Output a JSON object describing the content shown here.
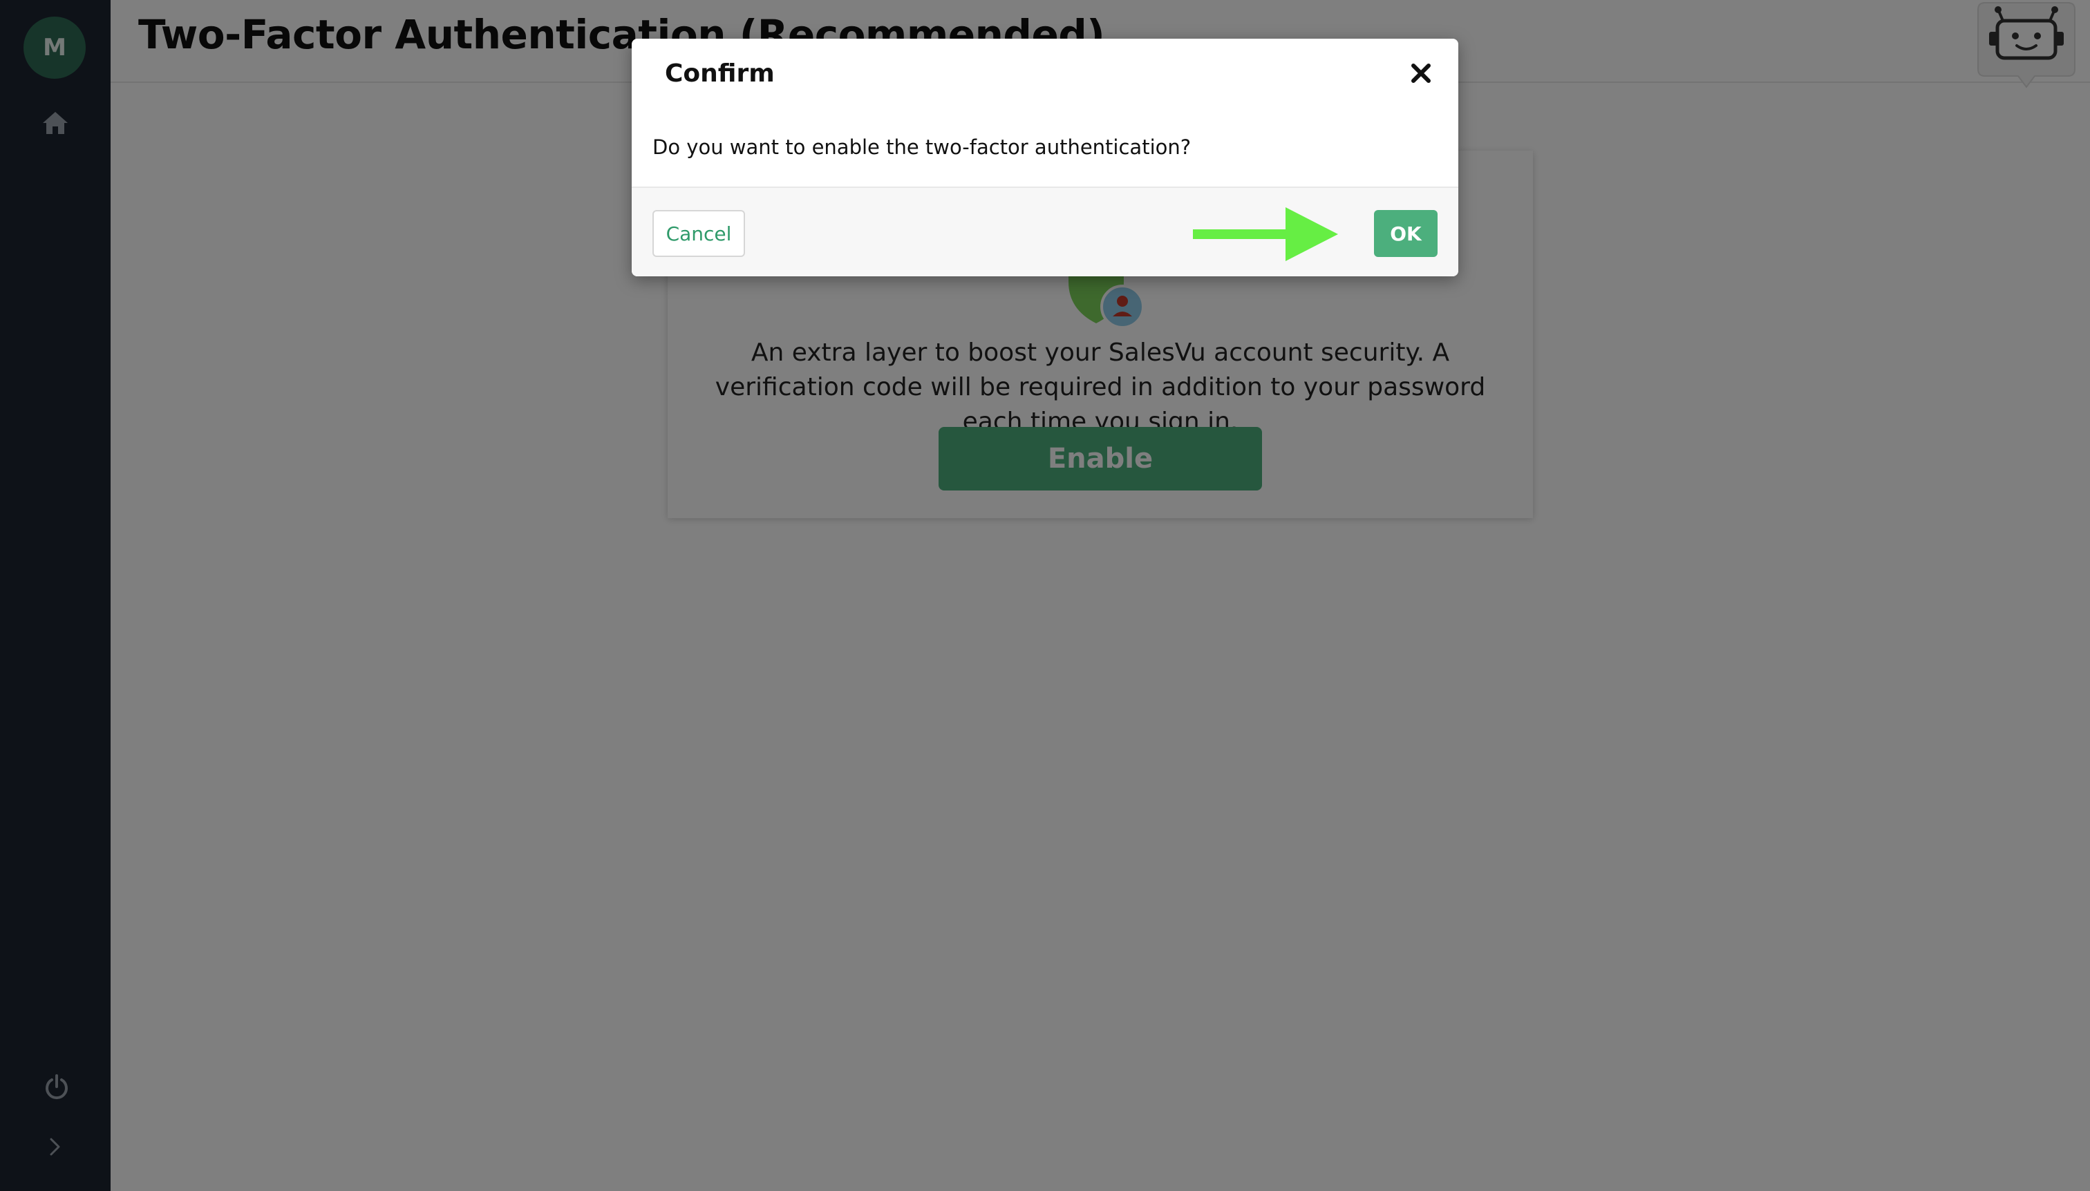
{
  "sidebar": {
    "avatar_initial": "M",
    "icons": [
      "home-icon",
      "power-icon",
      "chevron-right-icon"
    ]
  },
  "header": {
    "title": "Two-Factor Authentication (Recommended)",
    "assistant_icon": "robot-icon"
  },
  "card": {
    "illustration_icon": "shield-user-icon",
    "description": "An extra layer to boost your SalesVu account security. A verification code will be required in addition to your password each time you sign in.",
    "enable_label": "Enable"
  },
  "modal": {
    "title": "Confirm",
    "close_icon": "close-icon",
    "message": "Do you want to enable the two-factor authentication?",
    "cancel_label": "Cancel",
    "ok_label": "OK",
    "pointer_icon": "arrow-right-icon"
  },
  "colors": {
    "sidebar_bg": "#1c2531",
    "accent_green": "#4caf7d",
    "cancel_text": "#2f9a6a",
    "pointer_arrow": "#66ee44"
  }
}
